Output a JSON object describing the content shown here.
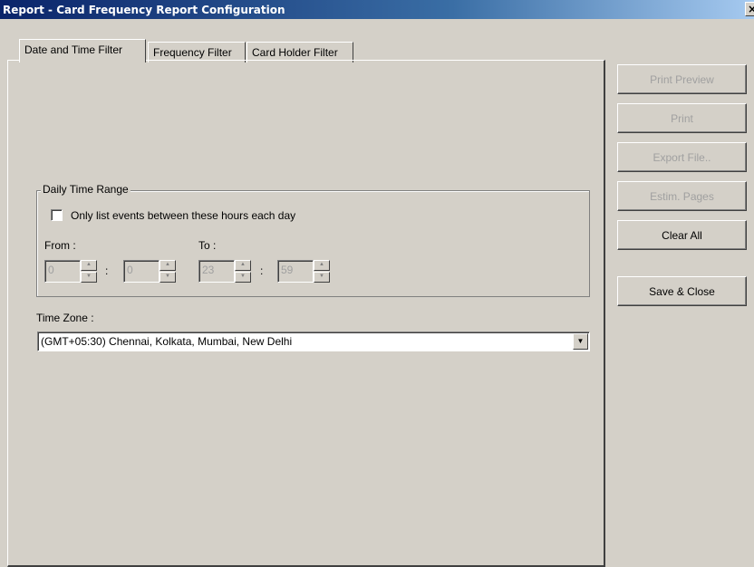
{
  "window": {
    "title": "Report  - Card Frequency Report Configuration",
    "close_label": "×"
  },
  "tabs": [
    {
      "label": "Date and Time Filter",
      "active": true
    },
    {
      "label": "Frequency Filter",
      "active": false
    },
    {
      "label": "Card Holder Filter",
      "active": false
    }
  ],
  "daily_time_range": {
    "legend": "Daily Time Range",
    "checkbox_label": "Only list events between these hours each day",
    "checked": false,
    "from_label": "From :",
    "to_label": "To :",
    "separator": ":",
    "from_hour": "0",
    "from_minute": "0",
    "to_hour": "23",
    "to_minute": "59"
  },
  "time_zone": {
    "label": "Time Zone :",
    "selected": "(GMT+05:30) Chennai, Kolkata, Mumbai, New Delhi"
  },
  "buttons": {
    "print_preview": "Print Preview",
    "print": "Print",
    "export_file": "Export File..",
    "estim_pages": "Estim. Pages",
    "clear_all": "Clear All",
    "save_close": "Save & Close"
  },
  "icons": {
    "spin_up": "▲",
    "spin_down": "▼",
    "dropdown": "▼"
  }
}
